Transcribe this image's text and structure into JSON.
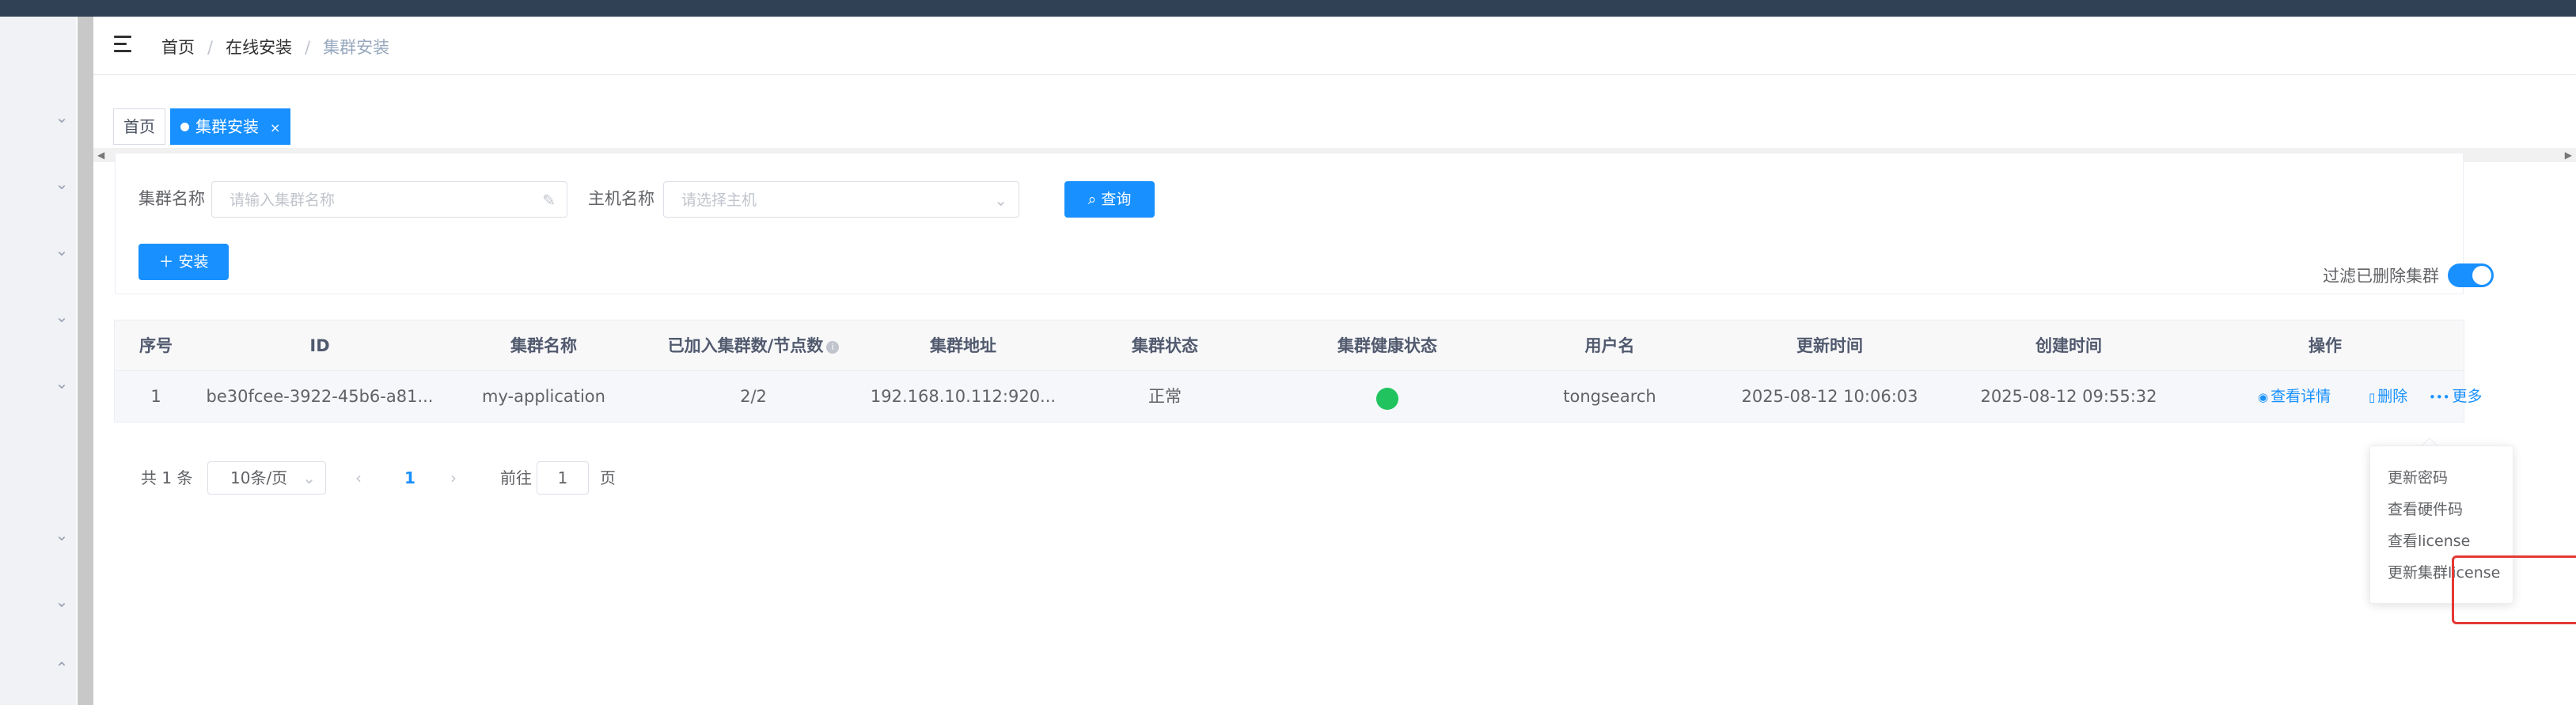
{
  "breadcrumb": [
    "首页",
    "在线安装",
    "集群安装"
  ],
  "tags": [
    {
      "label": "首页",
      "active": false
    },
    {
      "label": "集群安装",
      "active": true,
      "close": "×"
    }
  ],
  "search": {
    "cluster_name_label": "集群名称",
    "cluster_name_placeholder": "请输入集群名称",
    "host_name_label": "主机名称",
    "host_name_placeholder": "请选择主机",
    "query_label": "查询",
    "install_label": "安装",
    "filter_deleted_label": "过滤已删除集群"
  },
  "table": {
    "columns": [
      "序号",
      "ID",
      "集群名称",
      "已加入集群数/节点数",
      "集群地址",
      "集群状态",
      "集群健康状态",
      "用户名",
      "更新时间",
      "创建时间",
      "操作"
    ],
    "rows": [
      {
        "index": "1",
        "id": "be30fcee-3922-45b6-a81...",
        "name": "my-application",
        "nodes": "2/2",
        "address": "192.168.10.112:920...",
        "status": "正常",
        "username": "tongsearch",
        "updated": "2025-08-12 10:06:03",
        "created": "2025-08-12 09:55:32"
      }
    ],
    "actions": {
      "view": "查看详情",
      "delete": "删除",
      "more": "更多"
    }
  },
  "pagination": {
    "total": "共 1 条",
    "page_size": "10条/页",
    "current_page": "1",
    "goto_label": "前往",
    "goto_value": "1",
    "page_suffix": "页"
  },
  "dropdown": [
    "更新密码",
    "查看硬件码",
    "查看license",
    "更新集群license"
  ],
  "colors": {
    "primary": "#1890ff",
    "health_ok": "#21c35e",
    "highlight": "#e53935",
    "topbar": "#304156"
  }
}
